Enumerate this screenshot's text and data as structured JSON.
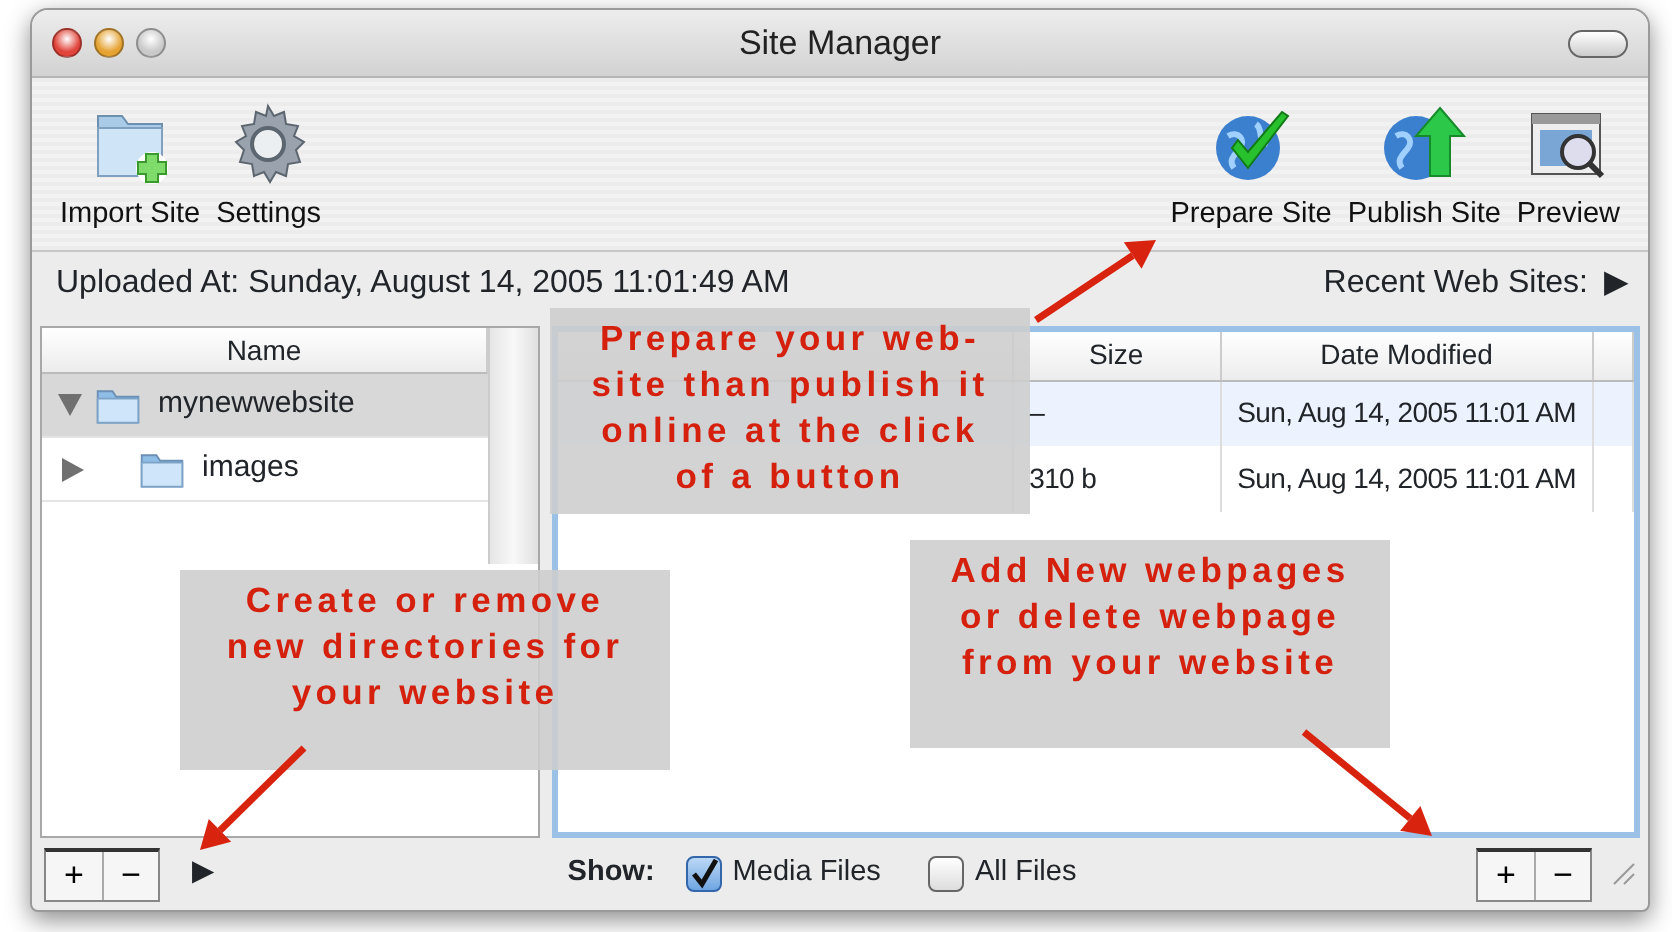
{
  "window": {
    "title": "Site Manager"
  },
  "toolbar": {
    "left": [
      {
        "label": "Import Site",
        "kind": "import"
      },
      {
        "label": "Settings",
        "kind": "gear"
      }
    ],
    "right": [
      {
        "label": "Prepare Site",
        "kind": "prepare"
      },
      {
        "label": "Publish Site",
        "kind": "publish"
      },
      {
        "label": "Preview",
        "kind": "preview"
      }
    ]
  },
  "status": {
    "uploaded": "Uploaded At: Sunday, August 14, 2005 11:01:49 AM",
    "recent": "Recent Web Sites:",
    "recent_arrow": "▶"
  },
  "tree": {
    "header": "Name",
    "items": [
      {
        "name": "mynewwebsite",
        "expanded": true,
        "selected": true,
        "children": [
          {
            "name": "images",
            "expanded": false,
            "selected": false
          }
        ]
      }
    ]
  },
  "files": {
    "columns": [
      "Size",
      "Date Modified"
    ],
    "rows": [
      {
        "size": "–",
        "date": "Sun, Aug 14, 2005 11:01 AM"
      },
      {
        "size": "310 b",
        "date": "Sun, Aug 14, 2005 11:01 AM"
      }
    ]
  },
  "bottom": {
    "left_buttons": [
      "+",
      "−"
    ],
    "left_arrow": "▶",
    "show_label": "Show:",
    "checkboxes": [
      {
        "label": "Media Files",
        "checked": true
      },
      {
        "label": "All Files",
        "checked": false
      }
    ],
    "right_buttons": [
      "+",
      "−"
    ]
  },
  "callouts": [
    {
      "lines": [
        "Prepare your web-",
        "site than publish it",
        "online at the click",
        "of a button"
      ]
    },
    {
      "lines": [
        "Create or remove",
        "new directories for",
        "your website"
      ]
    },
    {
      "lines": [
        "Add New webpages",
        "or delete webpage",
        "from your website"
      ]
    }
  ]
}
